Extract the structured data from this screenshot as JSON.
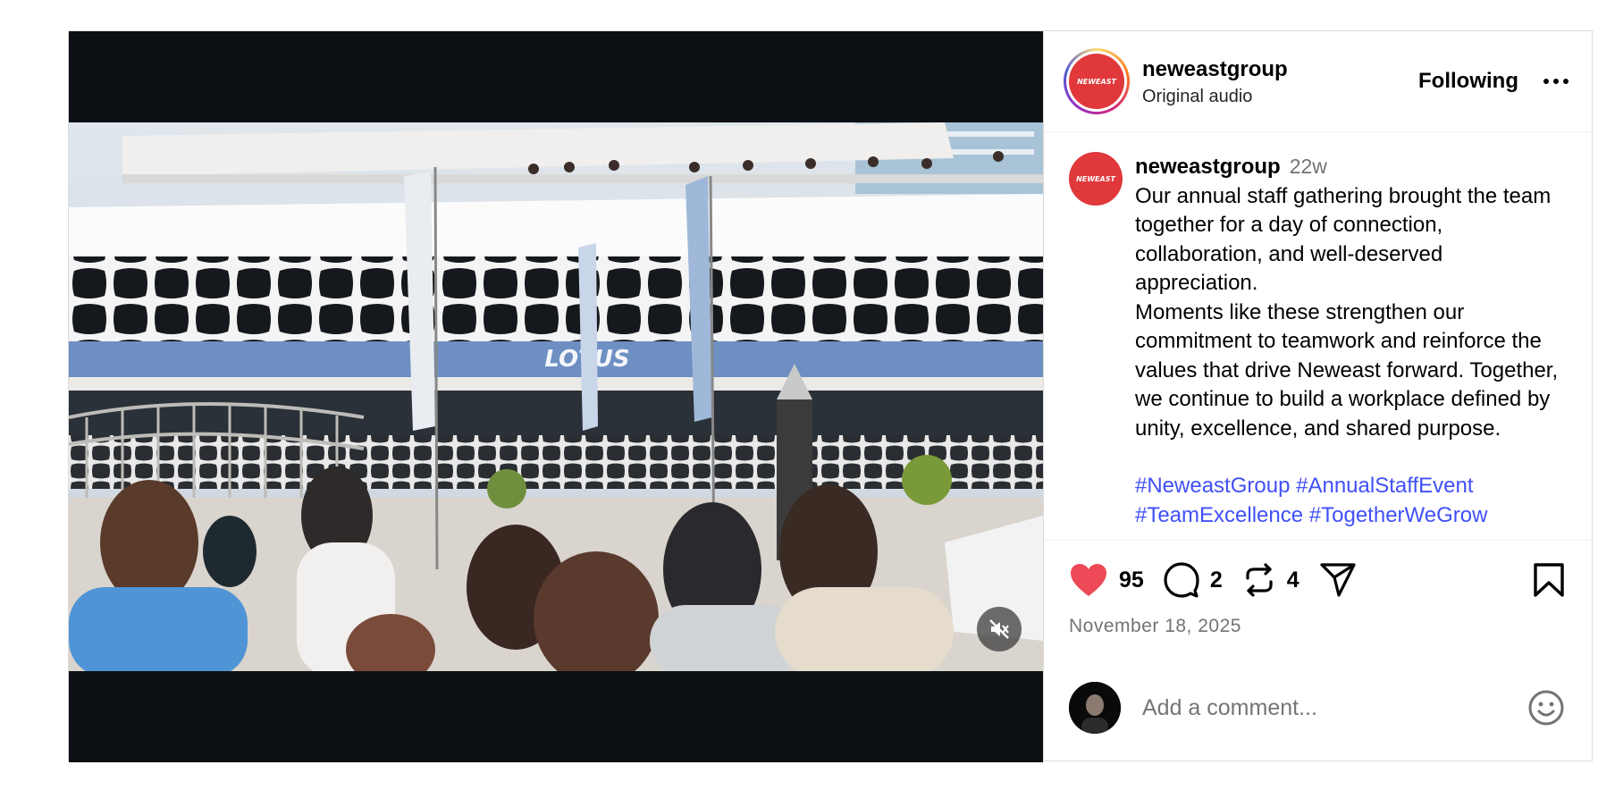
{
  "post": {
    "author": "neweastgroup",
    "avatar_text": "NEWEAST",
    "audio": "Original audio",
    "follow_label": "Following",
    "caption": {
      "username": "neweastgroup",
      "time": "22w",
      "text": "Our annual staff gathering brought the team together for a day of connection, collaboration, and well-deserved appreciation.\nMoments like these strengthen our commitment to teamwork and reinforce the values that drive Neweast forward. Together, we continue to build a workplace defined by unity, excellence, and shared purpose.",
      "hashtags": [
        "#NeweastGroup",
        "#AnnualStaffEvent",
        "#TeamExcellence",
        "#TogetherWeGrow"
      ]
    },
    "media": {
      "sign_text": "LOTUS"
    },
    "likes": "95",
    "comments": "2",
    "reposts": "4",
    "date": "November 18, 2025",
    "comment_placeholder": "Add a comment..."
  },
  "colors": {
    "like": "#ed4956",
    "hashtag": "#4150f7",
    "avatar_bg": "#e0383b",
    "video_bg": "#0c1014"
  },
  "icons": [
    "heart-icon",
    "comment-icon",
    "repost-icon",
    "share-icon",
    "bookmark-icon",
    "more-icon",
    "mute-icon",
    "emoji-icon"
  ]
}
